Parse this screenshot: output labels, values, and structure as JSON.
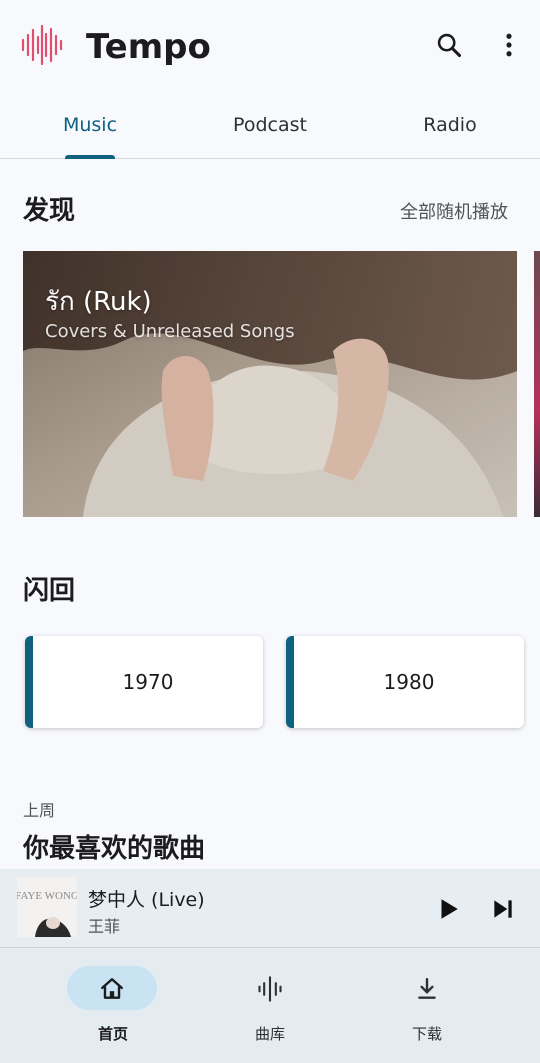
{
  "app": {
    "title": "Tempo",
    "brand_color": "#e0506e"
  },
  "header": {
    "search_icon": "search-icon",
    "more_icon": "more-vert-icon"
  },
  "tabs": [
    {
      "label": "Music",
      "active": true
    },
    {
      "label": "Podcast",
      "active": false
    },
    {
      "label": "Radio",
      "active": false
    }
  ],
  "discover": {
    "title": "发现",
    "shuffle_all": "全部随机播放",
    "hero": {
      "title": "รัก (Ruk)",
      "subtitle": "Covers & Unreleased Songs"
    }
  },
  "flashback": {
    "title": "闪回",
    "decades": [
      "1970",
      "1980"
    ]
  },
  "last_week": {
    "label": "上周",
    "title": "你最喜欢的歌曲"
  },
  "mini_player": {
    "cover_text": "FAYE WONG",
    "title": "梦中人 (Live)",
    "artist": "王菲",
    "play_icon": "play-icon",
    "next_icon": "skip-next-icon"
  },
  "bottom_nav": [
    {
      "label": "首页",
      "icon": "home-icon",
      "active": true
    },
    {
      "label": "曲库",
      "icon": "waveform-icon",
      "active": false
    },
    {
      "label": "下载",
      "icon": "download-icon",
      "active": false
    }
  ],
  "colors": {
    "accent": "#0f6180",
    "background": "#f8f9fd",
    "nav_pill": "#c9e3f3"
  }
}
